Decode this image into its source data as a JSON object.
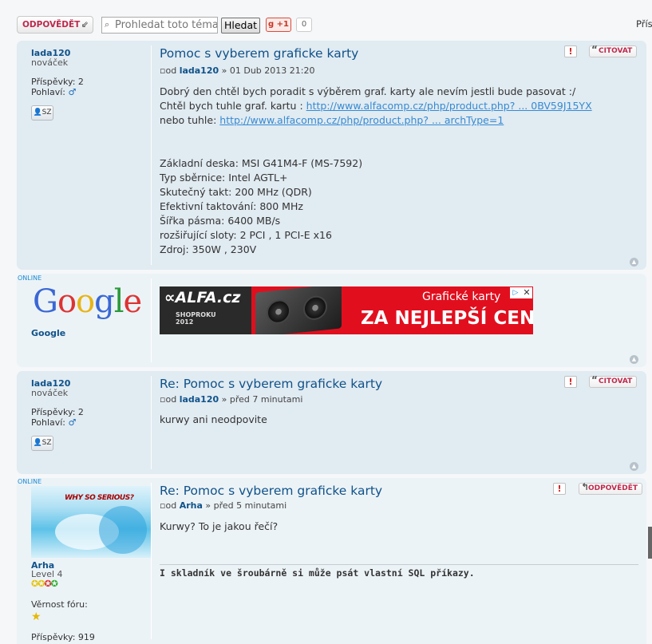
{
  "toolbar": {
    "reply_label": "ODPOVĚDĚT",
    "search_placeholder": "Prohledat toto téma",
    "search_button": "Hledat",
    "gplus_label": "+1",
    "gplus_count": "0",
    "cut_text": "Přís"
  },
  "posts": [
    {
      "username": "lada120",
      "rank": "nováček",
      "posts_label": "Příspěvky:",
      "posts_count": "2",
      "gender_label": "Pohlaví:",
      "pm_label": "SZ",
      "title": "Pomoc s vyberem graficke karty",
      "meta_prefix": "od",
      "meta_author": "lada120",
      "meta_time": "» 01 Dub 2013 21:20",
      "quote_label": "CITOVAT",
      "lines": [
        "Dobrý den chtěl bych poradit s výběrem graf. karty ale nevím jestli bude pasovat :/",
        "Chtěl bych tuhle graf. kartu : ",
        "nebo tuhle: "
      ],
      "link1": "http://www.alfacomp.cz/php/product.php? ... 0BV59J15YX",
      "link2": "http://www.alfacomp.cz/php/product.php? ... archType=1",
      "specs": [
        "Základní deska: MSI G41M4-F (MS-7592)",
        "Typ sběrnice: Intel AGTL+",
        "Skutečný takt: 200 MHz (QDR)",
        "Efektivní taktování: 800 MHz",
        "Šířka pásma: 6400 MB/s",
        "rozšiřující sloty: 2 PCI , 1 PCI-E x16",
        "Zdroj: 350W , 230V"
      ]
    },
    {
      "online_label": "ONLINE",
      "username": "Google",
      "ad": {
        "logo": "ALFA.cz",
        "shop_line1": "SHOPROKU",
        "shop_line2": "2012",
        "subtitle": "Grafické karty",
        "headline": "ZA NEJLEPŠÍ CENY"
      }
    },
    {
      "username": "lada120",
      "rank": "nováček",
      "posts_label": "Příspěvky:",
      "posts_count": "2",
      "gender_label": "Pohlaví:",
      "pm_label": "SZ",
      "title": "Re: Pomoc s vyberem graficke karty",
      "meta_prefix": "od",
      "meta_author": "lada120",
      "meta_time": "» před 7 minutami",
      "quote_label": "CITOVAT",
      "text": "kurwy ani neodpovite"
    },
    {
      "online_label": "ONLINE",
      "username": "Arha",
      "rank": "Level 4",
      "avatar_text": "WHY SO SERIOUS?",
      "loyalty_label": "Věrnost fóru:",
      "posts_label": "Příspěvky: 919",
      "title": "Re: Pomoc s vyberem graficke karty",
      "meta_prefix": "od",
      "meta_author": "Arha",
      "meta_time": "» před 5 minutami",
      "reply_label": "ODPOVĚDĚT",
      "text": "Kurwy? To je jakou řečí?",
      "signature": "I skladník ve šroubárně si může psát vlastní SQL příkazy."
    }
  ]
}
